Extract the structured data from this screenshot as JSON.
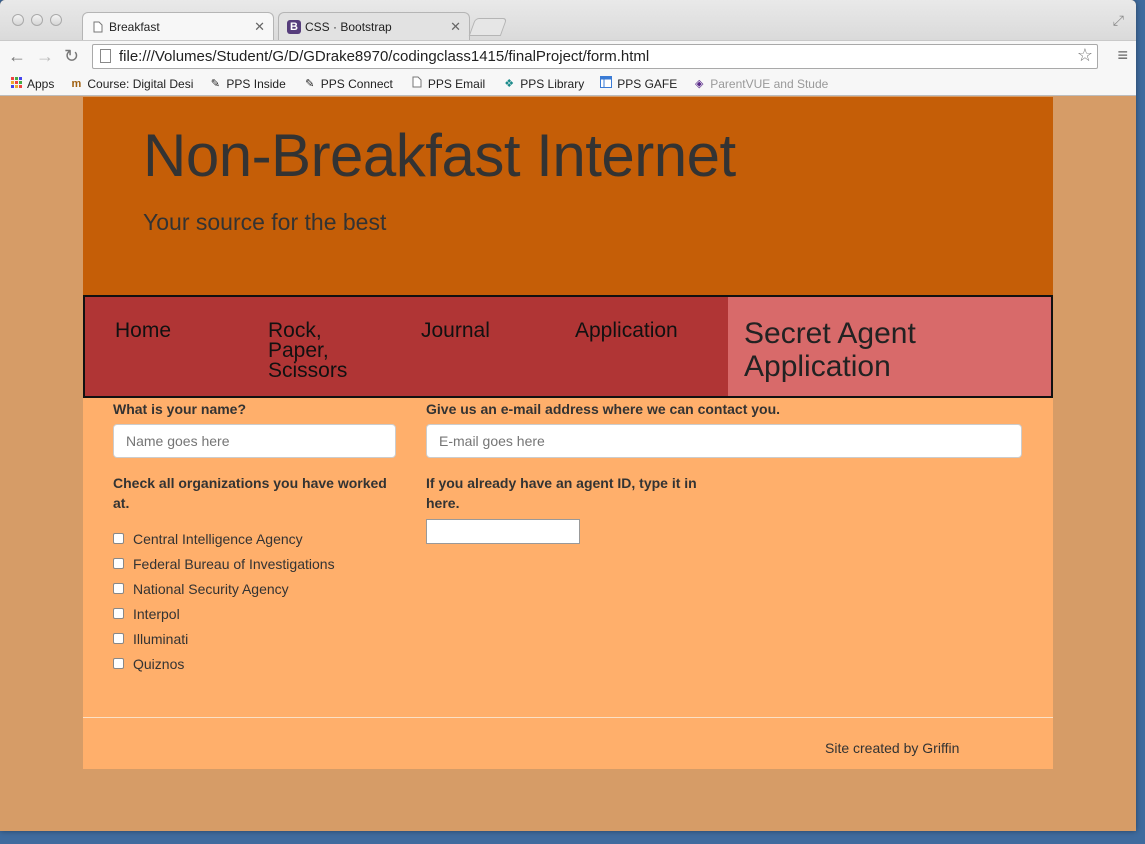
{
  "browser": {
    "tabs": [
      {
        "title": "Breakfast",
        "active": true
      },
      {
        "title": "CSS · Bootstrap",
        "active": false,
        "favicon": "B"
      }
    ],
    "url": "file:///Volumes/Student/G/D/GDrake8970/codingclass1415/finalProject/form.html",
    "bookmarks": [
      {
        "label": "Apps",
        "icon": "apps-grid-icon"
      },
      {
        "label": "Course: Digital Desi",
        "icon": "course-icon"
      },
      {
        "label": "PPS Inside",
        "icon": "pps-icon"
      },
      {
        "label": "PPS Connect",
        "icon": "pps-icon"
      },
      {
        "label": "PPS Email",
        "icon": "page-icon"
      },
      {
        "label": "PPS Library",
        "icon": "library-icon"
      },
      {
        "label": "PPS GAFE",
        "icon": "gafe-icon"
      },
      {
        "label": "ParentVUE and Stude",
        "icon": "parentvue-icon"
      }
    ]
  },
  "site": {
    "title": "Non-Breakfast Internet",
    "subtitle": "Your source for the best"
  },
  "nav": {
    "items": [
      {
        "label": "Home"
      },
      {
        "label": "Rock, Paper, Scissors"
      },
      {
        "label": "Journal"
      },
      {
        "label": "Application"
      },
      {
        "label": "Secret Agent Application",
        "active": true
      }
    ]
  },
  "form": {
    "name_label": "What is your name?",
    "name_placeholder": "Name goes here",
    "email_label": "Give us an e-mail address where we can contact you.",
    "email_placeholder": "E-mail goes here",
    "orgs_label": "Check all organizations you have worked at.",
    "orgs": [
      {
        "label": "Central Intelligence Agency",
        "checked": false
      },
      {
        "label": "Federal Bureau of Investigations",
        "checked": false
      },
      {
        "label": "National Security Agency",
        "checked": false
      },
      {
        "label": "Interpol",
        "checked": false
      },
      {
        "label": "Illuminati",
        "checked": false
      },
      {
        "label": "Quiznos",
        "checked": false
      }
    ],
    "agent_id_label": "If you already have an agent ID, type it in here.",
    "agent_id_value": ""
  },
  "footer": {
    "text": "Site created by Griffin"
  },
  "colors": {
    "outer_bg": "#d69c67",
    "page_bg": "#ffaf6b",
    "jumbotron_bg": "#c55e07",
    "navbar_bg": "#b03535",
    "nav_active_bg": "#d86a6a"
  }
}
